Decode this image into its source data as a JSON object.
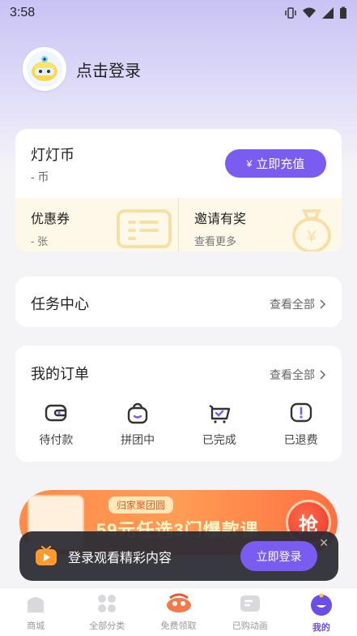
{
  "status": {
    "time": "3:58"
  },
  "profile": {
    "login_label": "点击登录"
  },
  "coin": {
    "title": "灯灯币",
    "value": "- 币",
    "recharge_symbol": "¥",
    "recharge_label": "立即充值",
    "coupon_title": "优惠券",
    "coupon_value": "- 张",
    "invite_title": "邀请有奖",
    "invite_sub": "查看更多"
  },
  "tasks": {
    "title": "任务中心",
    "link": "查看全部"
  },
  "orders": {
    "title": "我的订单",
    "link": "查看全部",
    "items": [
      {
        "label": "待付款",
        "icon": "wallet-icon"
      },
      {
        "label": "拼团中",
        "icon": "group-bag-icon"
      },
      {
        "label": "已完成",
        "icon": "completed-cart-icon"
      },
      {
        "label": "已退费",
        "icon": "refund-alert-icon"
      }
    ]
  },
  "banner": {
    "tag": "归家聚团圆",
    "text": "59元任选3门爆款课",
    "button": "抢"
  },
  "toast": {
    "text": "登录观看精彩内容",
    "button": "立即登录",
    "close": "✕"
  },
  "tabs": [
    {
      "label": "商城",
      "icon": "mall-icon"
    },
    {
      "label": "全部分类",
      "icon": "categories-icon"
    },
    {
      "label": "免费领取",
      "icon": "free-gift-icon"
    },
    {
      "label": "已购动画",
      "icon": "purchased-video-icon"
    },
    {
      "label": "我的",
      "icon": "profile-icon",
      "active": true
    }
  ],
  "colors": {
    "accent": "#7a5cf0",
    "active_tab": "#6b4ee8",
    "banner": "#ff8a4a"
  }
}
